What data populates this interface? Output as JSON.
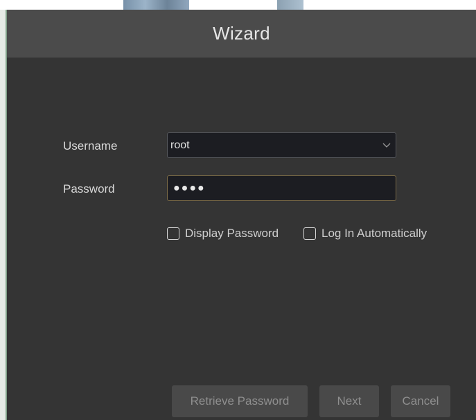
{
  "dialog": {
    "title": "Wizard"
  },
  "form": {
    "username_label": "Username",
    "username_value": "root",
    "password_label": "Password",
    "password_mask": "●●●●"
  },
  "options": {
    "display_password_label": "Display Password",
    "display_password_checked": false,
    "auto_login_label": "Log In Automatically",
    "auto_login_checked": false
  },
  "buttons": {
    "retrieve_label": "Retrieve Password",
    "next_label": "Next",
    "cancel_label": "Cancel"
  },
  "icons": {
    "username_dropdown": "chevron-down-icon",
    "display_password_box": "checkbox-icon",
    "auto_login_box": "checkbox-icon"
  },
  "colors": {
    "dialog_bg": "#343434",
    "titlebar_bg": "#4b4b4b",
    "field_bg": "#1c1d22",
    "focus_border": "#7a6a46",
    "button_bg": "#494949"
  }
}
